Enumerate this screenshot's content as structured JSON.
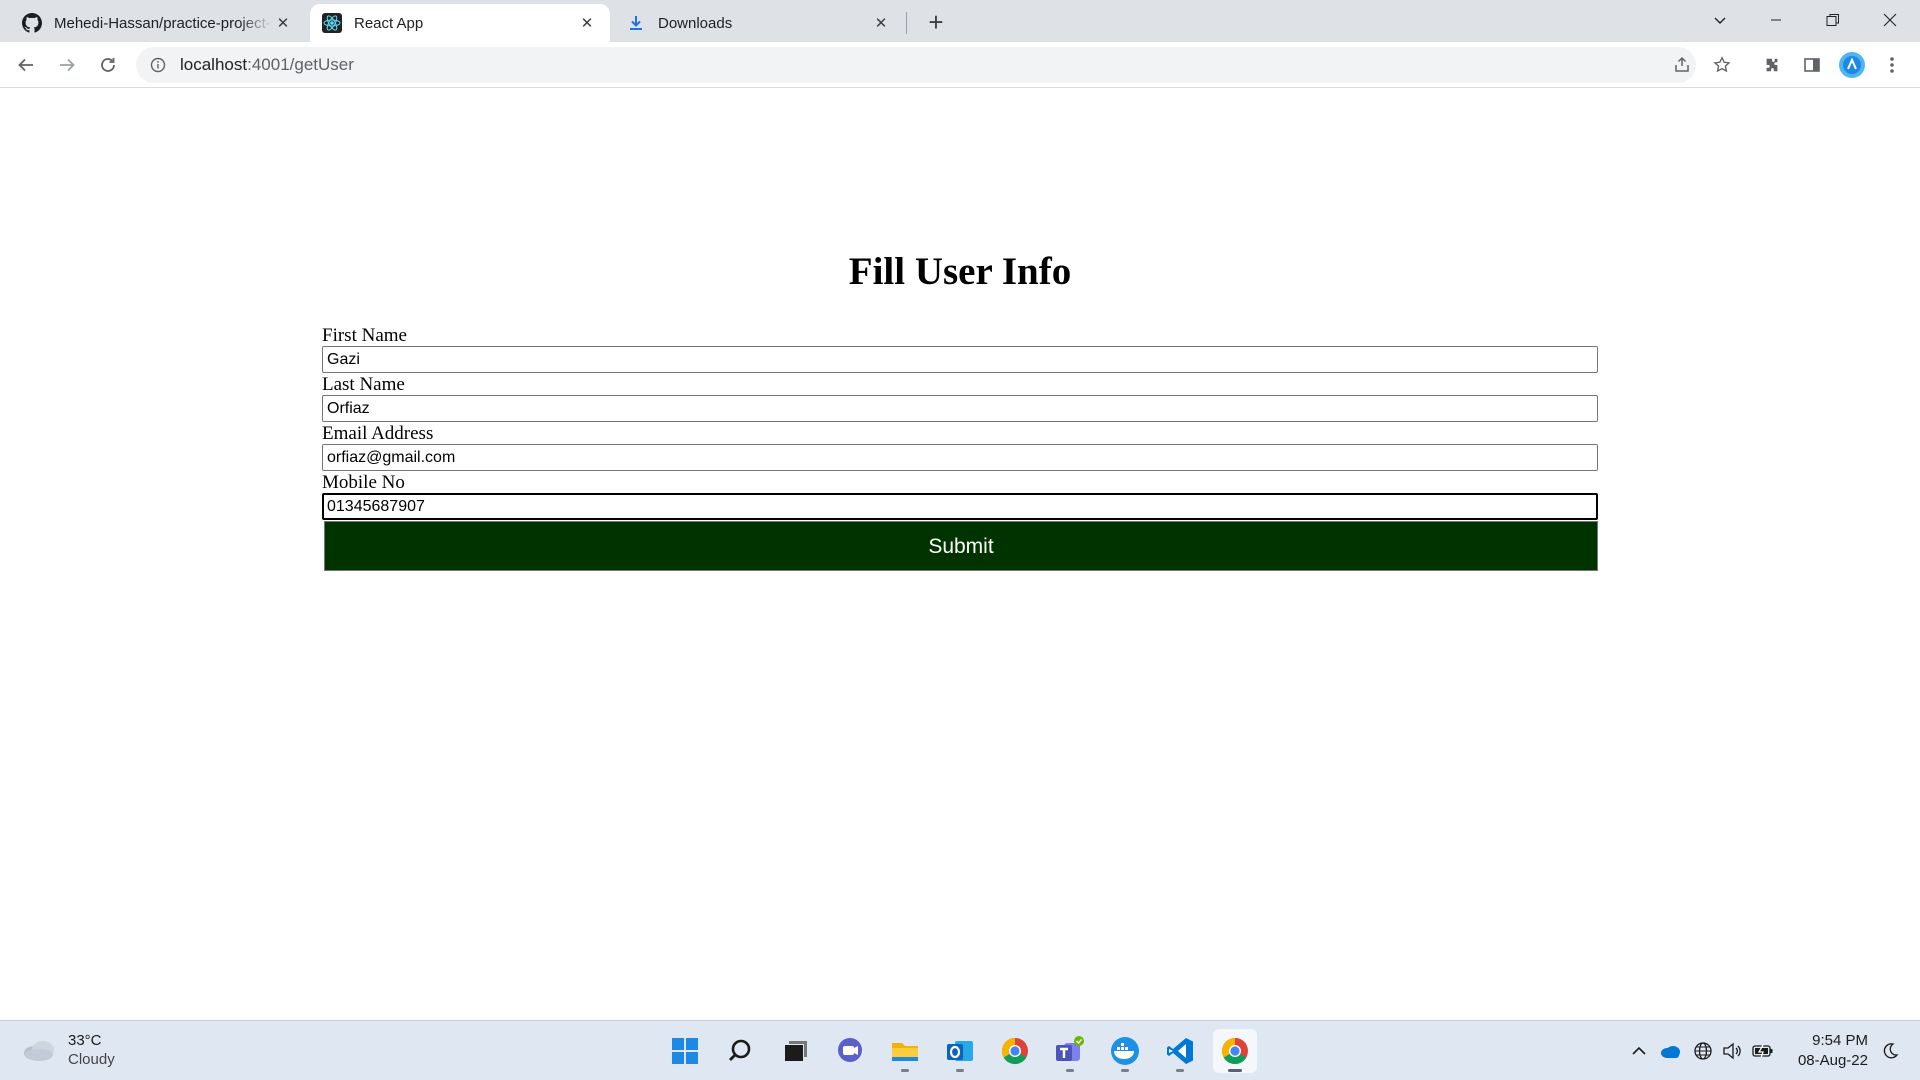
{
  "browser": {
    "tabs": [
      {
        "title": "Mehedi-Hassan/practice-project-",
        "favicon": "github-icon",
        "active": false
      },
      {
        "title": "React App",
        "favicon": "react-icon",
        "active": true
      },
      {
        "title": "Downloads",
        "favicon": "download-icon",
        "active": false
      }
    ],
    "url_host": "localhost",
    "url_path": ":4001/getUser"
  },
  "page": {
    "title": "Fill User Info",
    "fields": [
      {
        "label": "First Name",
        "value": "Gazi",
        "focused": false
      },
      {
        "label": "Last Name",
        "value": "Orfiaz",
        "focused": false
      },
      {
        "label": "Email Address",
        "value": "orfiaz@gmail.com",
        "focused": false
      },
      {
        "label": "Mobile No",
        "value": "01345687907",
        "focused": true
      }
    ],
    "submit_label": "Submit",
    "submit_color": "#003300"
  },
  "taskbar": {
    "weather_temp": "33°C",
    "weather_condition": "Cloudy",
    "time": "9:54 PM",
    "date": "08-Aug-22",
    "pinned_apps": [
      "windows-start-icon",
      "search-icon",
      "task-view-icon",
      "chat-icon",
      "file-explorer-icon",
      "outlook-icon",
      "chrome-icon",
      "teams-icon",
      "docker-icon",
      "vscode-icon",
      "chrome-active-icon"
    ]
  }
}
